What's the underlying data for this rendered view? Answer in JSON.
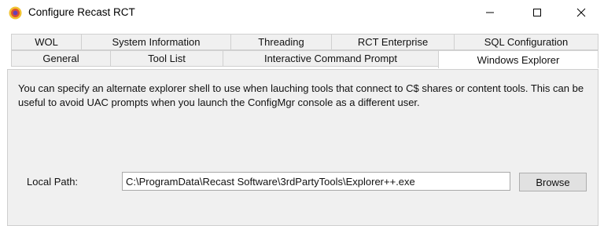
{
  "window": {
    "title": "Configure Recast RCT",
    "app_icon": "recast-logo-icon",
    "controls": {
      "minimize": "minimize-icon",
      "maximize": "maximize-icon",
      "close": "close-icon"
    }
  },
  "tabs": {
    "row_top": [
      {
        "label": "WOL"
      },
      {
        "label": "System Information"
      },
      {
        "label": "Threading"
      },
      {
        "label": "RCT Enterprise"
      },
      {
        "label": "SQL Configuration"
      }
    ],
    "row_bottom": [
      {
        "label": "General"
      },
      {
        "label": "Tool List"
      },
      {
        "label": "Interactive Command Prompt"
      },
      {
        "label": "Windows Explorer",
        "active": true
      }
    ]
  },
  "content": {
    "description": "You can specify an alternate explorer shell to use when lauching tools that connect to C$ shares or content tools. This can be useful to avoid UAC prompts when you launch the ConfigMgr console as a different user.",
    "local_path_label": "Local Path:",
    "local_path_value": "C:\\ProgramData\\Recast Software\\3rdPartyTools\\Explorer++.exe",
    "browse_label": "Browse"
  }
}
